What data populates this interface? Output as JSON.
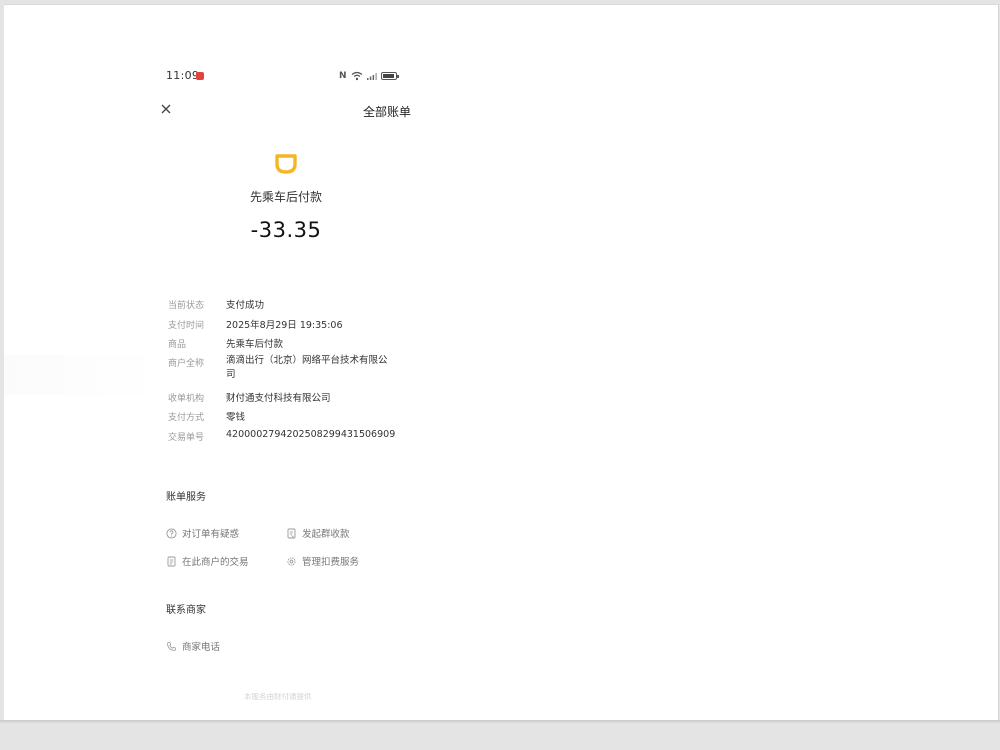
{
  "status_bar": {
    "time": "11:09",
    "icons": [
      "nfc-icon",
      "wifi-icon",
      "signal-icon",
      "battery-icon"
    ],
    "nfc_glyph": "N"
  },
  "header": {
    "title": "全部账单",
    "close_icon": "close-icon"
  },
  "merchant": {
    "logo_icon": "didi-logo-icon",
    "logo_color": "#f5b625",
    "name": "先乘车后付款",
    "amount": "-33.35"
  },
  "details": [
    {
      "label": "当前状态",
      "value": "支付成功"
    },
    {
      "label": "支付时间",
      "value": "2025年8月29日 19:35:06"
    },
    {
      "label": "商品",
      "value": "先乘车后付款"
    },
    {
      "label": "商户全称",
      "value": "滴滴出行（北京）网络平台技术有限公司"
    },
    {
      "label": "收单机构",
      "value": "财付通支付科技有限公司"
    },
    {
      "label": "支付方式",
      "value": "零钱"
    },
    {
      "label": "交易单号",
      "value": "4200002794202508299431506909"
    }
  ],
  "bill_services": {
    "title": "账单服务",
    "items": [
      {
        "label": "对订单有疑惑",
        "icon": "question-circle-icon"
      },
      {
        "label": "发起群收款",
        "icon": "group-receipt-icon"
      },
      {
        "label": "在此商户的交易",
        "icon": "document-icon"
      },
      {
        "label": "管理扣费服务",
        "icon": "gear-icon"
      }
    ]
  },
  "contact": {
    "title": "联系商家",
    "phone_label": "商家电话",
    "phone_icon": "phone-icon"
  },
  "footer": {
    "text": "本服务由财付通提供"
  }
}
